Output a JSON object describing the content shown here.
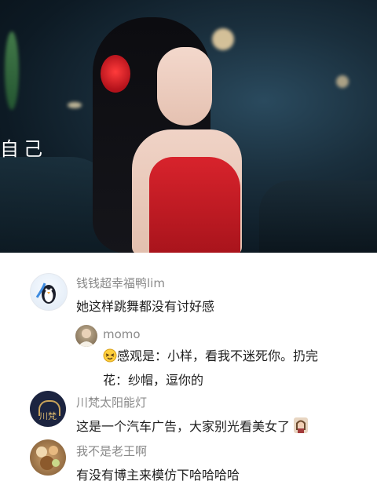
{
  "video": {
    "subtitle": "自己"
  },
  "comments": [
    {
      "name": "钱钱超幸福鸭lim",
      "text": "她这样跳舞都没有讨好感",
      "reply": {
        "name": "momo",
        "text_before": "感观是：小样，看我不迷死你。扔完花：纱帽，逗你的",
        "emoji": "squinting-face-icon"
      }
    },
    {
      "name": "川梵太阳能灯",
      "text": "这是一个汽车广告，大家别光看美女了",
      "avatar_label": "川梵",
      "emoji": "lady-sticker-icon"
    },
    {
      "name": "我不是老王啊",
      "text": "有没有博主来模仿下哈哈哈哈"
    }
  ],
  "colors": {
    "name_gray": "#8a8a8a",
    "text_dark": "#1f1f1f",
    "dress_red": "#d8232c"
  }
}
